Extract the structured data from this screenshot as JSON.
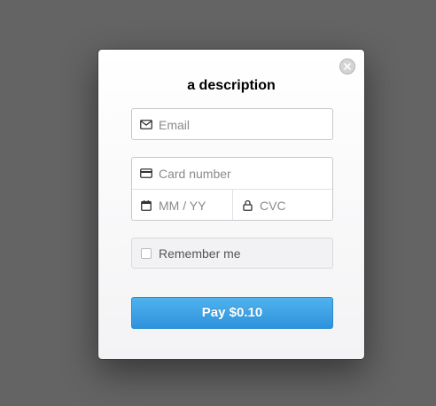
{
  "checkout": {
    "title": "a description",
    "email": {
      "placeholder": "Email",
      "value": "",
      "icon": "envelope-icon"
    },
    "card_number": {
      "placeholder": "Card number",
      "value": "",
      "icon": "credit-card-icon"
    },
    "expiry": {
      "placeholder": "MM / YY",
      "value": "",
      "icon": "calendar-icon"
    },
    "cvc": {
      "placeholder": "CVC",
      "value": "",
      "icon": "lock-icon"
    },
    "remember_me": {
      "label": "Remember me",
      "checked": false
    },
    "pay_button_label": "Pay $0.10",
    "close_icon": "close-icon"
  },
  "colors": {
    "backdrop": "#646464",
    "pay_button": "#3aa0e6",
    "placeholder_text": "#8a8a8f"
  }
}
